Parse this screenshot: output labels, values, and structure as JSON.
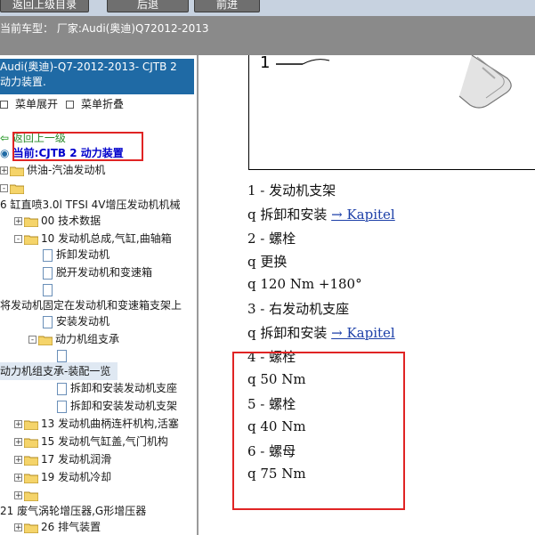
{
  "toolbar": {
    "btn1": "返回上级目录",
    "btn2": "后退",
    "btn3": "前进"
  },
  "vehicle": {
    "label": "当前车型：",
    "value": "厂家:Audi(奥迪)Q72012-2013"
  },
  "sidebar": {
    "title_line1": "Audi(奥迪)-Q7-2012-2013- CJTB 2",
    "title_line2": "动力装置.",
    "expand": "菜单展开",
    "collapse": "菜单折叠",
    "back": "返回上一级",
    "current": "当前:CJTB 2 动力装置",
    "tree": [
      {
        "label": "供油-汽油发动机"
      },
      {
        "label": ""
      },
      {
        "label": "6 缸直喷3.0l TFSI 4V增压发动机机械"
      },
      {
        "label": "00 技术数据"
      },
      {
        "label": "10 发动机总成,气缸,曲轴箱"
      },
      {
        "label": "拆卸发动机"
      },
      {
        "label": "脱开发动机和变速箱"
      },
      {
        "label": ""
      },
      {
        "label": "将发动机固定在发动机和变速箱支架上"
      },
      {
        "label": "安装发动机"
      },
      {
        "label": "动力机组支承"
      },
      {
        "label": ""
      },
      {
        "label": "动力机组支承-装配一览"
      },
      {
        "label": "拆卸和安装发动机支座"
      },
      {
        "label": "拆卸和安装发动机支架"
      },
      {
        "label": "13 发动机曲柄连杆机构,活塞"
      },
      {
        "label": "15 发动机气缸盖,气门机构"
      },
      {
        "label": "17 发动机润滑"
      },
      {
        "label": "19 发动机冷却"
      },
      {
        "label": ""
      },
      {
        "label": "21 废气涡轮增压器,G形增压器"
      },
      {
        "label": "26 排气装置"
      }
    ]
  },
  "figure": {
    "callout": "1"
  },
  "content": {
    "items": [
      {
        "text": "1 -  发动机支架"
      },
      {
        "text": "q  拆卸和安装 ",
        "link": "→ Kapitel"
      },
      {
        "text": "2 -  螺栓"
      },
      {
        "text": "q  更换"
      },
      {
        "text": "q  120 Nm +180°"
      },
      {
        "text": "3 -  右发动机支座"
      },
      {
        "text": "q  拆卸和安装 ",
        "link": "→ Kapitel"
      },
      {
        "text": "4 -  螺栓"
      },
      {
        "text": "q  50 Nm"
      },
      {
        "text": "5 -  螺栓"
      },
      {
        "text": "q  40 Nm"
      },
      {
        "text": "6 -  螺母"
      },
      {
        "text": "q  75 Nm"
      }
    ]
  },
  "colors": {
    "highlight_box": "#e02424",
    "sidebar_header": "#1f6aa5",
    "link": "#1c3fa8"
  }
}
